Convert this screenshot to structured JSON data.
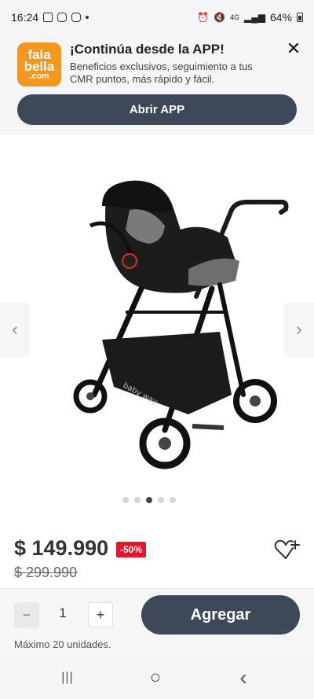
{
  "status_bar": {
    "time": "16:24",
    "signal_label": "4G",
    "battery": "64%"
  },
  "app_banner": {
    "logo_line1": "fala",
    "logo_line2": "bella",
    "logo_line3": ".com",
    "title": "¡Continúa desde la APP!",
    "subtitle": "Beneficios exclusivos, seguimiento a tus CMR puntos, más rápido y fácil.",
    "close_label": "✕",
    "open_button": "Abrir APP"
  },
  "gallery": {
    "prev_label": "‹",
    "next_label": "›",
    "dots_count": 5,
    "active_dot": 3,
    "stroller_brand": "baby way"
  },
  "product": {
    "price": "$ 149.990",
    "discount": "-50%",
    "old_price": "$ 299.990"
  },
  "purchase": {
    "minus": "−",
    "quantity": "1",
    "plus": "+",
    "add_button": "Agregar",
    "max_units": "Máximo 20 unidades."
  },
  "nav": {
    "recents": "|||",
    "home": "○",
    "back": "‹"
  },
  "colors": {
    "primary": "#3f4858",
    "discount": "#e0162b",
    "logo": "#f5961e"
  }
}
